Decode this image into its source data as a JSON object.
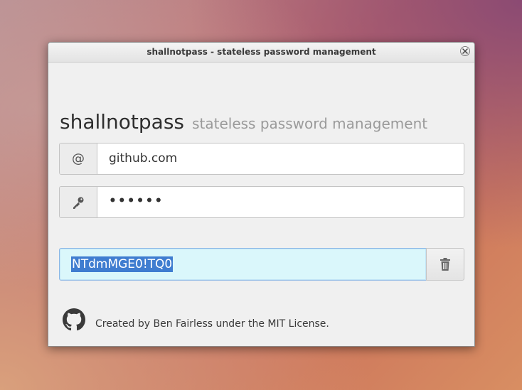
{
  "window": {
    "title": "shallnotpass - stateless password management"
  },
  "header": {
    "app_name": "shallnotpass",
    "tagline": "stateless password management"
  },
  "domain_field": {
    "icon": "at-sign-icon",
    "icon_glyph": "@",
    "value": "github.com"
  },
  "password_field": {
    "icon": "key-icon",
    "masked_value": "••••••"
  },
  "generated": {
    "value": "NTdmMGE0!TQ0",
    "selection_color": "#3f7dd0",
    "field_color": "#daf7fb"
  },
  "footer": {
    "icon": "github-icon",
    "text": "Created by Ben Fairless under the MIT License."
  }
}
